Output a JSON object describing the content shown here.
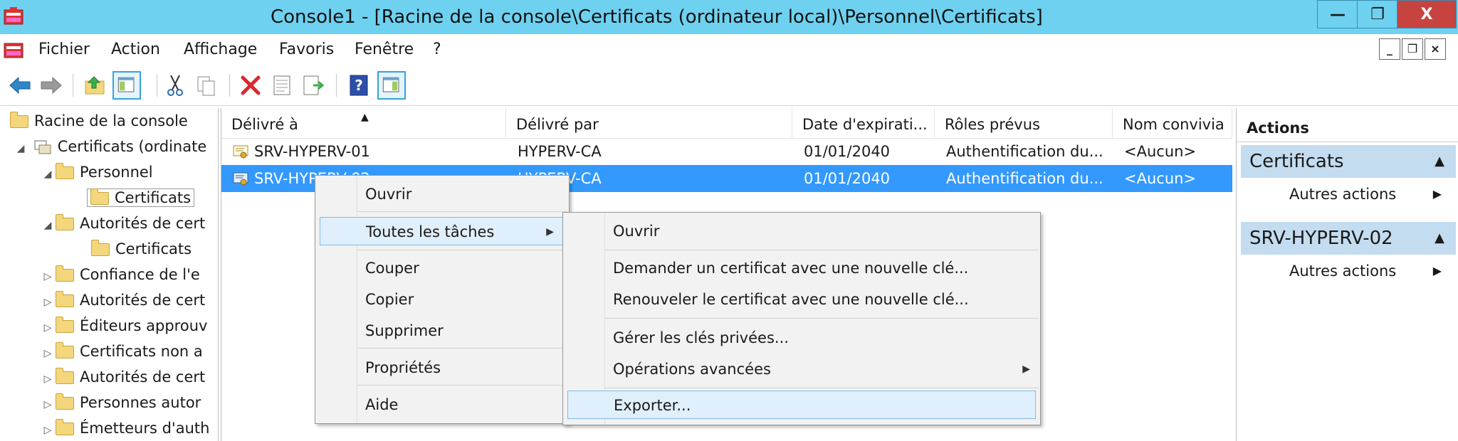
{
  "window": {
    "title": "Console1 - [Racine de la console\\Certificats (ordinateur local)\\Personnel\\Certificats]",
    "minimize": "—",
    "maximize": "❐",
    "close": "X"
  },
  "menubar": {
    "items": [
      "Fichier",
      "Action",
      "Affichage",
      "Favoris",
      "Fenêtre",
      "?"
    ],
    "mdi": {
      "minimize": "_",
      "restore": "❐",
      "close": "×"
    }
  },
  "toolbar": {
    "icons": [
      "back-arrow-icon",
      "forward-arrow-icon",
      "up-folder-icon",
      "show-hide-tree-icon",
      "cut-icon",
      "copy-icon",
      "delete-icon",
      "properties-icon",
      "export-list-icon",
      "help-icon",
      "show-hide-action-pane-icon"
    ]
  },
  "tree": {
    "root": "Racine de la console",
    "certificats": "Certificats (ordinate",
    "personnel": "Personnel",
    "personnel_certs": "Certificats",
    "autorites_racines": "Autorités de cert",
    "autorites_racines_certs": "Certificats",
    "confiance": "Confiance de l'e",
    "autorites_inter": "Autorités de cert",
    "editeurs": "Éditeurs approuv",
    "non_autorises": "Certificats non a",
    "autorites_tierces": "Autorités de cert",
    "personnes": "Personnes autor",
    "emetteurs": "Émetteurs d'auth"
  },
  "list": {
    "columns": [
      "Délivré à",
      "Délivré par",
      "Date d'expirati...",
      "Rôles prévus",
      "Nom convivia"
    ],
    "sort_indicator": "▲",
    "rows": [
      [
        "SRV-HYPERV-01",
        "HYPERV-CA",
        "01/01/2040",
        "Authentification du...",
        "<Aucun>"
      ],
      [
        "SRV-HYPERV-02",
        "HYPERV-CA",
        "01/01/2040",
        "Authentification du...",
        "<Aucun>"
      ]
    ]
  },
  "actions": {
    "title": "Actions",
    "sections": [
      {
        "header": "Certificats",
        "item": "Autres actions"
      },
      {
        "header": "SRV-HYPERV-02",
        "item": "Autres actions"
      }
    ]
  },
  "context_menu": {
    "open": "Ouvrir",
    "all_tasks": "Toutes les tâches",
    "cut": "Couper",
    "copy": "Copier",
    "delete": "Supprimer",
    "properties": "Propriétés",
    "help": "Aide"
  },
  "submenu": {
    "open": "Ouvrir",
    "request_new_key": "Demander un certificat avec une nouvelle clé...",
    "renew_new_key": "Renouveler le certificat avec une nouvelle clé...",
    "manage_keys": "Gérer les clés privées...",
    "advanced": "Opérations avancées",
    "export": "Exporter..."
  },
  "colors": {
    "titlebar": "#6fd1f0",
    "selection": "#3399ff",
    "close_button": "#c7433f",
    "action_header": "#c4dcf0"
  }
}
